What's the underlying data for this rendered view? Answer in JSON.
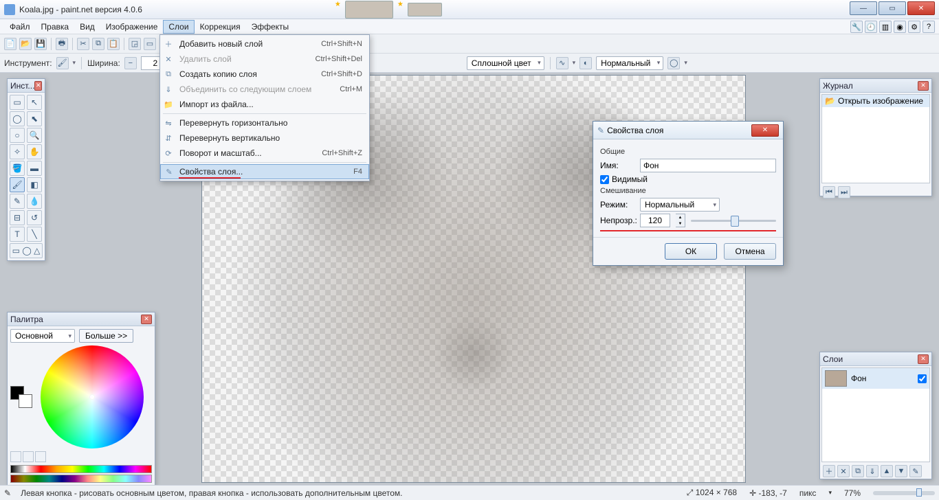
{
  "title": "Koala.jpg - paint.net версия 4.0.6",
  "menu": {
    "file": "Файл",
    "edit": "Правка",
    "view": "Вид",
    "image": "Изображение",
    "layers": "Слои",
    "adjust": "Коррекция",
    "effects": "Эффекты"
  },
  "dropdown": {
    "add": {
      "label": "Добавить новый слой",
      "shortcut": "Ctrl+Shift+N"
    },
    "del": {
      "label": "Удалить слой",
      "shortcut": "Ctrl+Shift+Del"
    },
    "dup": {
      "label": "Создать копию слоя",
      "shortcut": "Ctrl+Shift+D"
    },
    "merge": {
      "label": "Объединить со следующим слоем",
      "shortcut": "Ctrl+M"
    },
    "import": {
      "label": "Импорт из файла...",
      "shortcut": ""
    },
    "fliph": {
      "label": "Перевернуть горизонтально",
      "shortcut": ""
    },
    "flipv": {
      "label": "Перевернуть вертикально",
      "shortcut": ""
    },
    "rotzoom": {
      "label": "Поворот и масштаб...",
      "shortcut": "Ctrl+Shift+Z"
    },
    "props": {
      "label": "Свойства слоя...",
      "shortcut": "F4"
    }
  },
  "toolbar2": {
    "tool_label": "Инструмент:",
    "width_label": "Ширина:",
    "width_value": "2",
    "fill_label": "Сплошной цвет",
    "blend_label": "Нормальный"
  },
  "panel_tools": {
    "title": "Инст..."
  },
  "panel_palette": {
    "title": "Палитра",
    "primary": "Основной",
    "more": "Больше >>"
  },
  "panel_history": {
    "title": "Журнал",
    "item": "Открыть изображение"
  },
  "panel_layers": {
    "title": "Слои",
    "item": "Фон"
  },
  "dialog": {
    "title": "Свойства слоя",
    "group_general": "Общие",
    "name_label": "Имя:",
    "name_value": "Фон",
    "visible": "Видимый",
    "group_blend": "Смешивание",
    "mode_label": "Режим:",
    "mode_value": "Нормальный",
    "opacity_label": "Непрозр.:",
    "opacity_value": "120",
    "ok": "ОК",
    "cancel": "Отмена"
  },
  "status": {
    "hint": "Левая кнопка - рисовать основным цветом, правая кнопка - использовать дополнительным цветом.",
    "size": "1024 × 768",
    "pos": "-183, -7",
    "units": "пикс",
    "zoom": "77%"
  }
}
